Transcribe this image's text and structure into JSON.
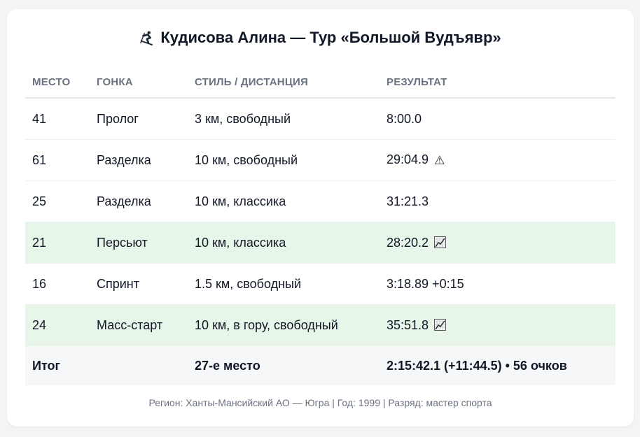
{
  "title": "Кудисова Алина — Тур «Большой Вудъявр»",
  "title_icon": "skier-icon",
  "table": {
    "headers": [
      "Место",
      "Гонка",
      "Стиль / дистанция",
      "Результат"
    ],
    "rows": [
      {
        "place": "41",
        "race": "Пролог",
        "style": "3 км, свободный",
        "result": "8:00.0",
        "mark": ""
      },
      {
        "place": "61",
        "race": "Разделка",
        "style": "10 км, свободный",
        "result": "29:04.9",
        "mark": "⚠"
      },
      {
        "place": "25",
        "race": "Разделка",
        "style": "10 км, классика",
        "result": "31:21.3",
        "mark": ""
      },
      {
        "place": "21",
        "race": "Персьют",
        "style": "10 км, классика",
        "result": "28:20.2",
        "mark": "chart-up-icon"
      },
      {
        "place": "16",
        "race": "Спринт",
        "style": "1.5 км, свободный",
        "result": "3:18.89 +0:15",
        "mark": ""
      },
      {
        "place": "24",
        "race": "Масс-старт",
        "style": "10 км, в гору, свободный",
        "result": "35:51.8",
        "mark": "chart-up-icon"
      }
    ],
    "total": {
      "label": "Итог",
      "race": "",
      "place": "27-е место",
      "result": "2:15:42.1 (+11:44.5) • 56 очков"
    }
  },
  "footer": "Регион: Ханты-Мансийский АО — Югра | Год: 1999 | Разряд: мастер спорта",
  "colors": {
    "highlight_row": "#e8f5e9",
    "total_row": "#f6f7f9",
    "header_text": "#6b7280"
  }
}
